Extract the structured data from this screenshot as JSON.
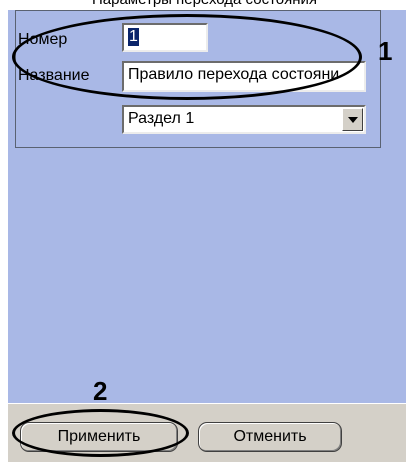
{
  "top_text": "Параметры перехода состояния",
  "fields": {
    "number_label": "Номер",
    "number_value": "1",
    "name_label": "Название",
    "name_value": "Правило перехода состояни",
    "section_value": "Раздел 1"
  },
  "callouts": [
    "1",
    "2"
  ],
  "buttons": {
    "apply": "Применить",
    "cancel": "Отменить"
  },
  "colors": {
    "panel_bg": "#a9b8e6",
    "button_bar_bg": "#d4d0c8"
  },
  "icons": {
    "dropdown": "chevron-down-icon"
  }
}
